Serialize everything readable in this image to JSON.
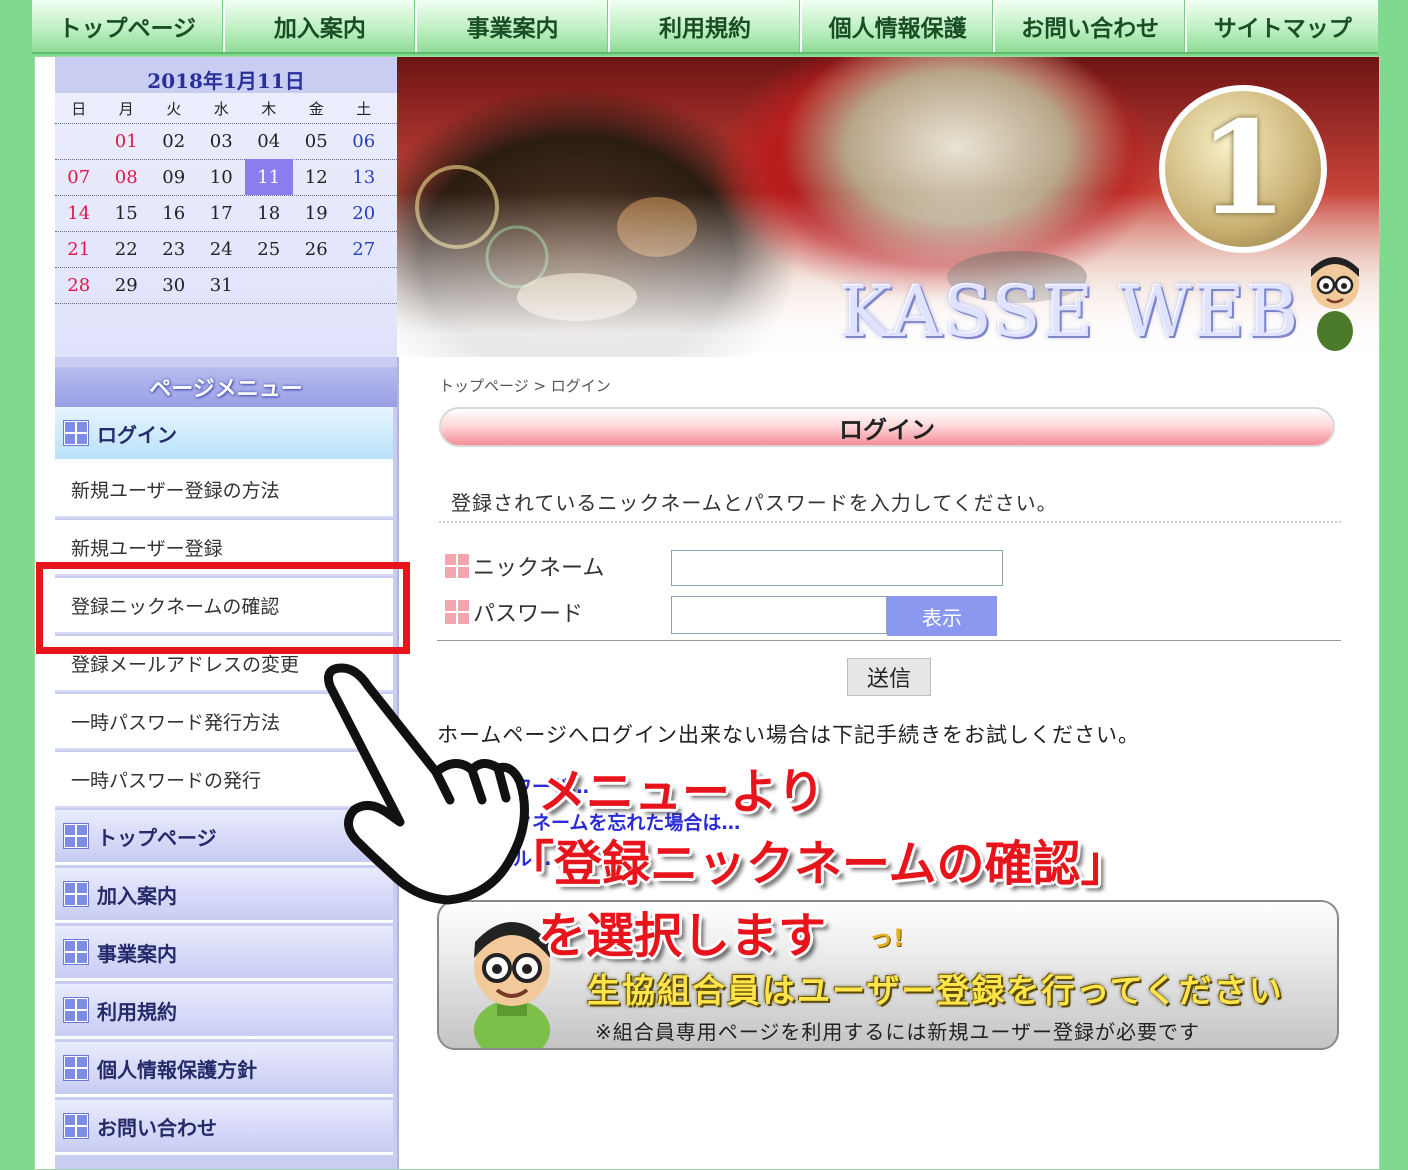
{
  "top_nav": [
    "トップページ",
    "加入案内",
    "事業案内",
    "利用規約",
    "個人情報保護",
    "お問い合わせ",
    "サイトマップ"
  ],
  "calendar": {
    "title": "2018年1月11日",
    "weekdays": [
      "日",
      "月",
      "火",
      "水",
      "木",
      "金",
      "土"
    ],
    "weeks": [
      [
        "",
        "01",
        "02",
        "03",
        "04",
        "05",
        "06"
      ],
      [
        "07",
        "08",
        "09",
        "10",
        "11",
        "12",
        "13"
      ],
      [
        "14",
        "15",
        "16",
        "17",
        "18",
        "19",
        "20"
      ],
      [
        "21",
        "22",
        "23",
        "24",
        "25",
        "26",
        "27"
      ],
      [
        "28",
        "29",
        "30",
        "31",
        "",
        "",
        ""
      ]
    ],
    "highlighted_red": [
      "01",
      "08"
    ],
    "today": "11"
  },
  "sidebar": {
    "menu_heading": "ページメニュー",
    "login_section": "ログイン",
    "login_items": [
      "新規ユーザー登録の方法",
      "新規ユーザー登録",
      "登録ニックネームの確認",
      "登録メールアドレスの変更",
      "一時パスワード発行方法",
      "一時パスワードの発行"
    ],
    "other_sections": [
      "トップページ",
      "加入案内",
      "事業案内",
      "利用規約",
      "個人情報保護方針",
      "お問い合わせ"
    ]
  },
  "banner": {
    "logo_text": "KASSE WEB",
    "medal_number": "1"
  },
  "main": {
    "breadcrumb": "トップページ > ログイン",
    "page_title": "ログイン",
    "instruction": "登録されているニックネームとパスワードを入力してください。",
    "nickname_label": "ニックネーム",
    "password_label": "パスワード",
    "nickname_value": "",
    "password_value": "",
    "show_button": "表示",
    "submit_button": "送信",
    "help_text": "ホームページへログイン出来ない場合は下記手続きをお試しください。",
    "help_links": [
      "パスワード…",
      "ニックネームを忘れた場合は…",
      "メール…"
    ]
  },
  "promo": {
    "top_text": "っ!",
    "main_text": "生協組合員はユーザー登録を行ってください",
    "note": "※組合員専用ページを利用するには新規ユーザー登録が必要です"
  },
  "overlay": {
    "lines": [
      "メニューより",
      "「登録ニックネームの確認」",
      "を選択します"
    ]
  },
  "colors": {
    "page_background": "#7fd98f",
    "sidebar": "#c9cdf2",
    "today_cell": "#8b7cf0",
    "accent_red": "#e8141c",
    "link_blue": "#2b2bd8"
  }
}
